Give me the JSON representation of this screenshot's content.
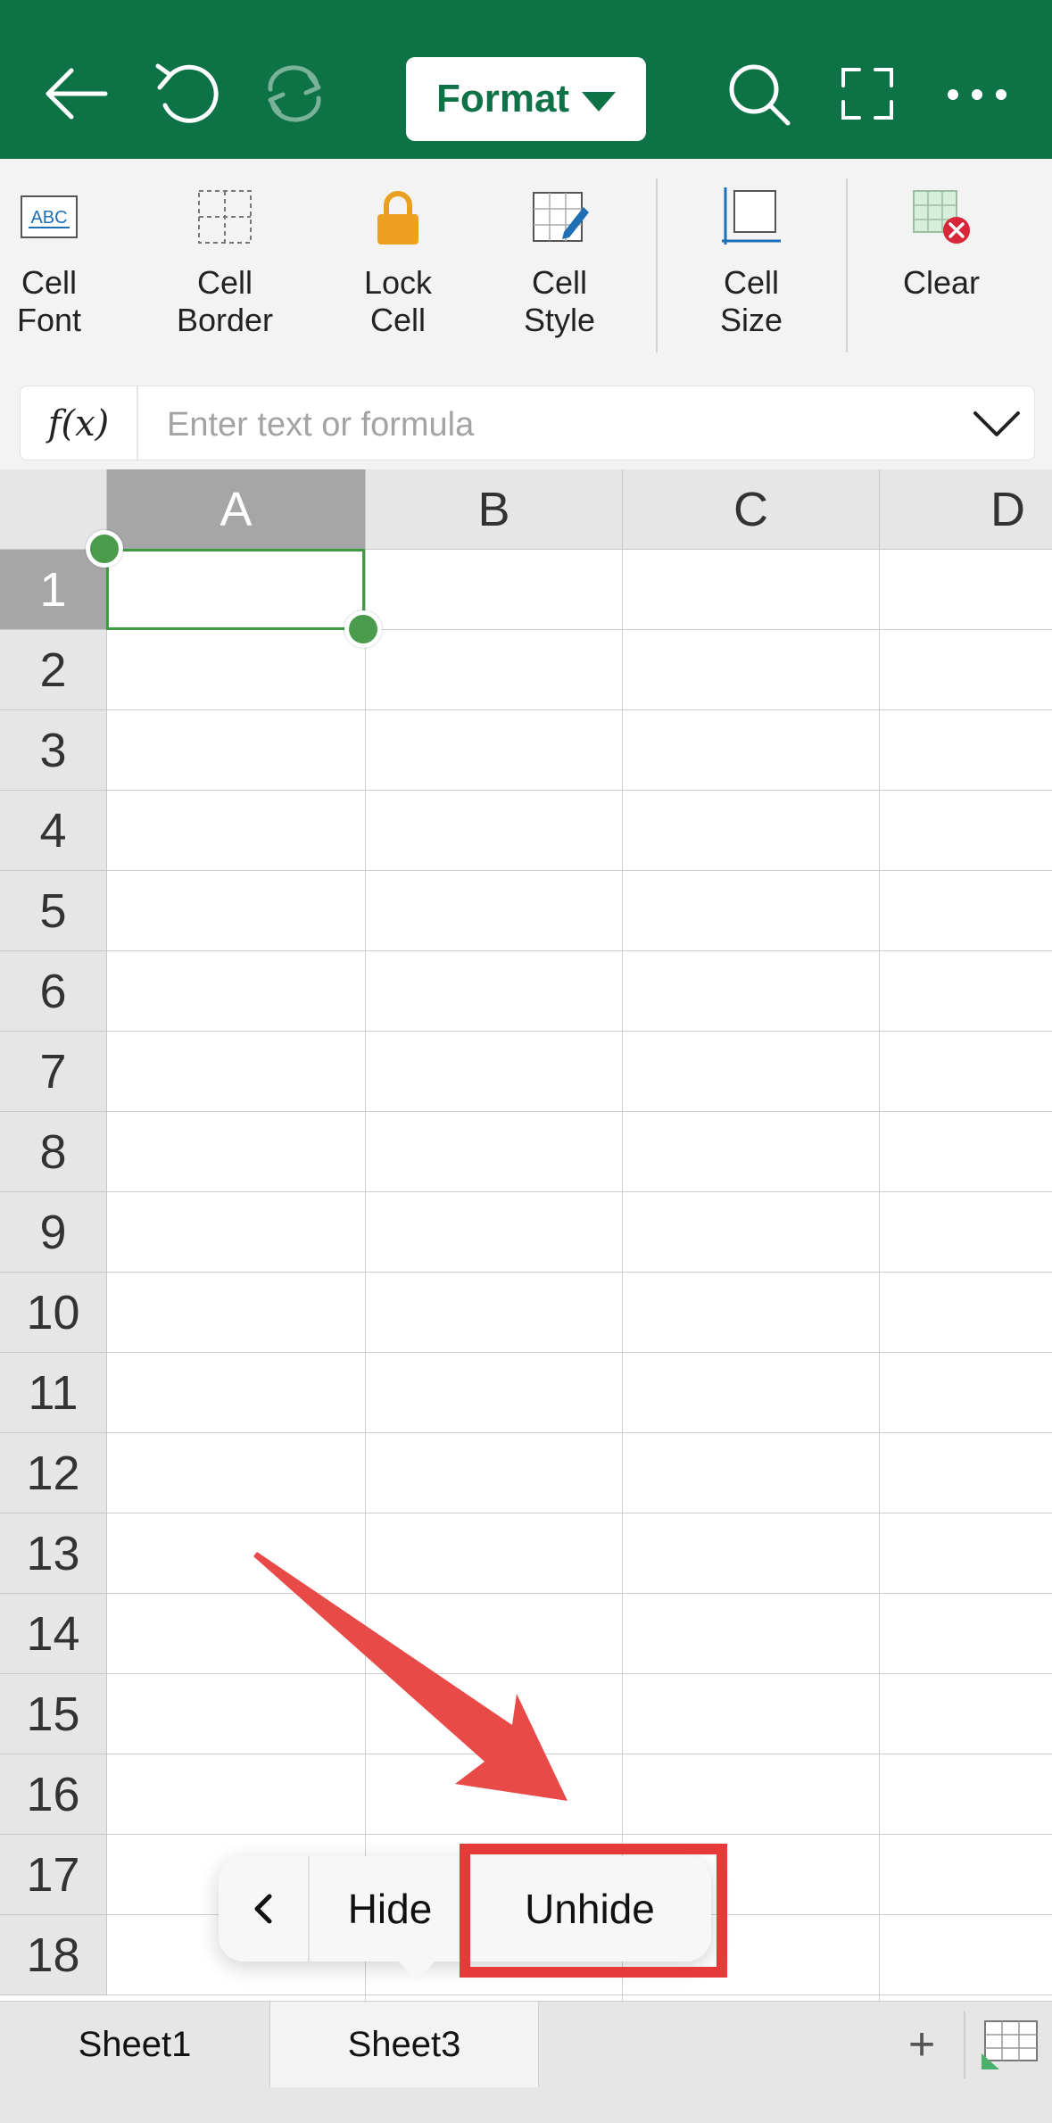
{
  "toolbar": {
    "icons": [
      "back-arrow-icon",
      "undo-icon",
      "redo-icon",
      "search-icon",
      "fullscreen-icon",
      "more-icon"
    ],
    "format_label": "Format",
    "accent": "#0d7246"
  },
  "ribbon": {
    "cell_font": "Cell\nFont",
    "cell_border": "Cell\nBorder",
    "lock_cell": "Lock\nCell",
    "cell_style": "Cell\nStyle",
    "cell_size": "Cell\nSize",
    "clear": "Clear"
  },
  "formula_bar": {
    "fx_label": "f(x)",
    "placeholder": "Enter text or formula"
  },
  "grid": {
    "columns": [
      "A",
      "B",
      "C",
      "D"
    ],
    "rows": [
      "1",
      "2",
      "3",
      "4",
      "5",
      "6",
      "7",
      "8",
      "9",
      "10",
      "11",
      "12",
      "13",
      "14",
      "15",
      "16",
      "17",
      "18"
    ],
    "selected_cell": "A1"
  },
  "context_menu": {
    "hide_label": "Hide",
    "unhide_label": "Unhide",
    "highlight_color": "#e63a3a"
  },
  "sheet_tabs": {
    "tabs": [
      "Sheet1",
      "Sheet3"
    ],
    "active": "Sheet3",
    "add_label": "+"
  }
}
